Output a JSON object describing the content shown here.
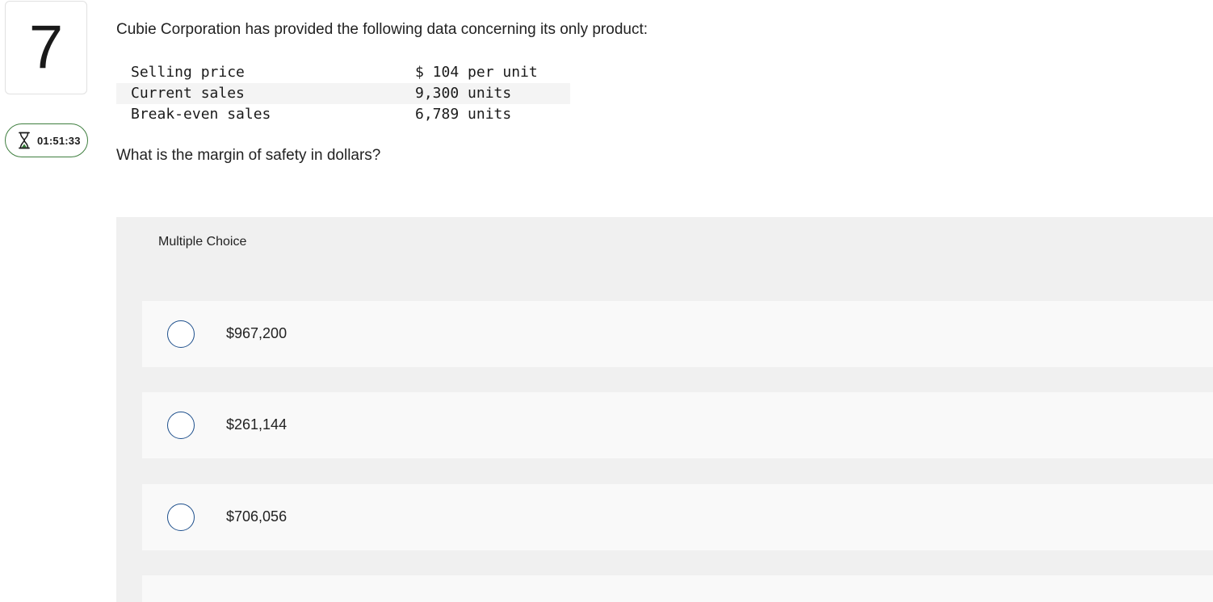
{
  "question": {
    "number": "7",
    "timer": "01:51:33",
    "prompt": "Cubie Corporation has provided the following data concerning its only product:",
    "data_rows": [
      {
        "label": "Selling price",
        "value": "$ 104 per unit"
      },
      {
        "label": "Current sales",
        "value": "9,300 units"
      },
      {
        "label": "Break-even sales",
        "value": "6,789 units"
      }
    ],
    "ask": "What is the margin of safety in dollars?"
  },
  "multiple_choice": {
    "header": "Multiple Choice",
    "options": [
      {
        "label": "$967,200"
      },
      {
        "label": "$261,144"
      },
      {
        "label": "$706,056"
      }
    ]
  },
  "colors": {
    "timer_border": "#3f7f3f",
    "radio_border": "#1d4f8c",
    "panel_bg": "#f0f0f0",
    "choice_bg": "#f9f9f9"
  },
  "icons": {
    "timer": "hourglass-icon"
  }
}
